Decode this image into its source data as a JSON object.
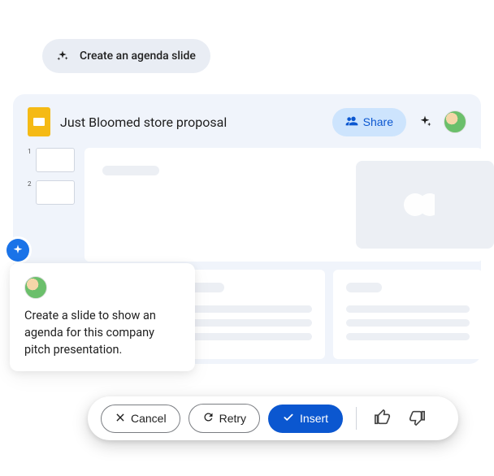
{
  "prompt_pill": {
    "label": "Create an agenda slide"
  },
  "window": {
    "title": "Just Bloomed store proposal",
    "share_label": "Share",
    "thumbs": [
      {
        "num": "1"
      },
      {
        "num": "2"
      }
    ]
  },
  "user_prompt": {
    "text": "Create a slide to show an agenda for this company pitch presentation."
  },
  "actions": {
    "cancel": "Cancel",
    "retry": "Retry",
    "insert": "Insert"
  }
}
